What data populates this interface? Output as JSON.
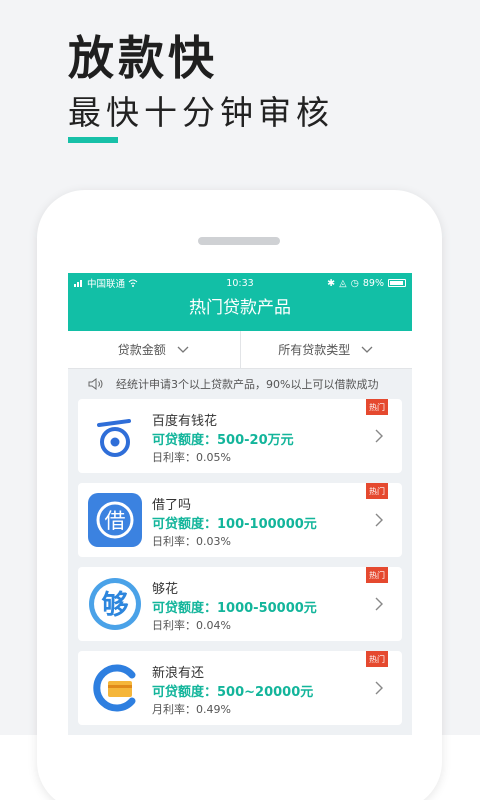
{
  "promo": {
    "headline": "放款快",
    "subline": "最快十分钟审核",
    "accent_color": "#17c0a8"
  },
  "status_bar": {
    "carrier": "中国联通",
    "time": "10:33",
    "battery_percent": "89%",
    "battery_level": 0.89,
    "icons": [
      "signal-icon",
      "wifi-icon",
      "bluetooth-icon",
      "mute-icon",
      "alarm-icon",
      "battery-icon"
    ]
  },
  "header": {
    "title": "热门贷款产品",
    "bg_color": "#12bfa6"
  },
  "filters": [
    {
      "label": "贷款金额"
    },
    {
      "label": "所有贷款类型"
    }
  ],
  "notice": {
    "text": "经统计申请3个以上贷款产品，90%以上可以借款成功"
  },
  "products": [
    {
      "name": "百度有钱花",
      "amount": "可贷额度：500-20万元",
      "rate": "日利率：0.05%",
      "tag": "热门",
      "logo": "baidu-money-logo"
    },
    {
      "name": "借了吗",
      "amount": "可贷额度：100-100000元",
      "rate": "日利率：0.03%",
      "tag": "热门",
      "logo": "jieleme-logo"
    },
    {
      "name": "够花",
      "amount": "可贷额度：1000-50000元",
      "rate": "日利率：0.04%",
      "tag": "热门",
      "logo": "gouhua-logo"
    },
    {
      "name": "新浪有还",
      "amount": "可贷额度：500~20000元",
      "rate": "月利率：0.49%",
      "tag": "热门",
      "logo": "sina-youhuan-logo"
    }
  ]
}
